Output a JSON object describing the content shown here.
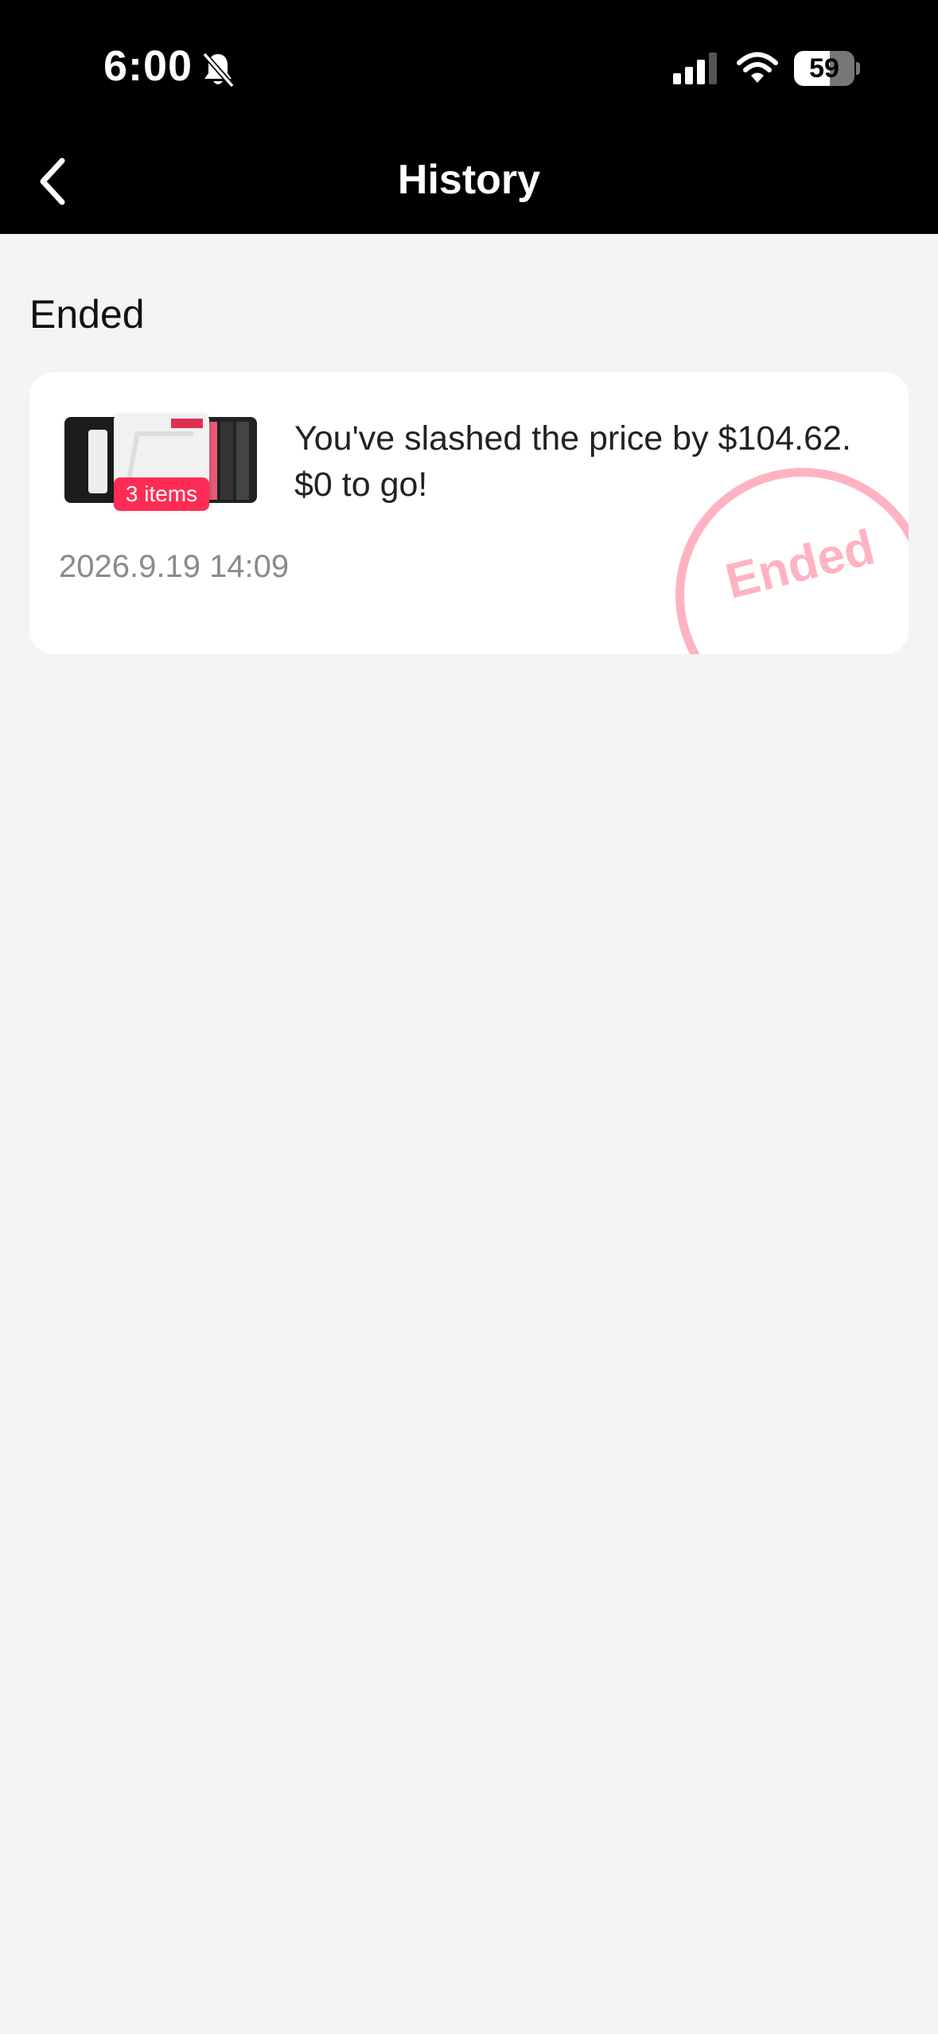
{
  "status_bar": {
    "time": "6:00",
    "battery": "59",
    "battery_level": 0.59,
    "icons": [
      "bell-slash-icon",
      "cellular-signal-icon",
      "wifi-icon",
      "battery-icon"
    ]
  },
  "header": {
    "title": "History",
    "back_icon": "chevron-left-icon"
  },
  "section": {
    "title": "Ended"
  },
  "card": {
    "items_badge": "3 items",
    "message": "You've slashed the price by $104.62. $0 to go!",
    "date": "2026.9.19 14:09",
    "stamp": "Ended"
  },
  "colors": {
    "accent": "#fe2c55",
    "stamp": "#ffb3c2",
    "header_bg": "#000000",
    "page_bg": "#f4f4f4"
  }
}
